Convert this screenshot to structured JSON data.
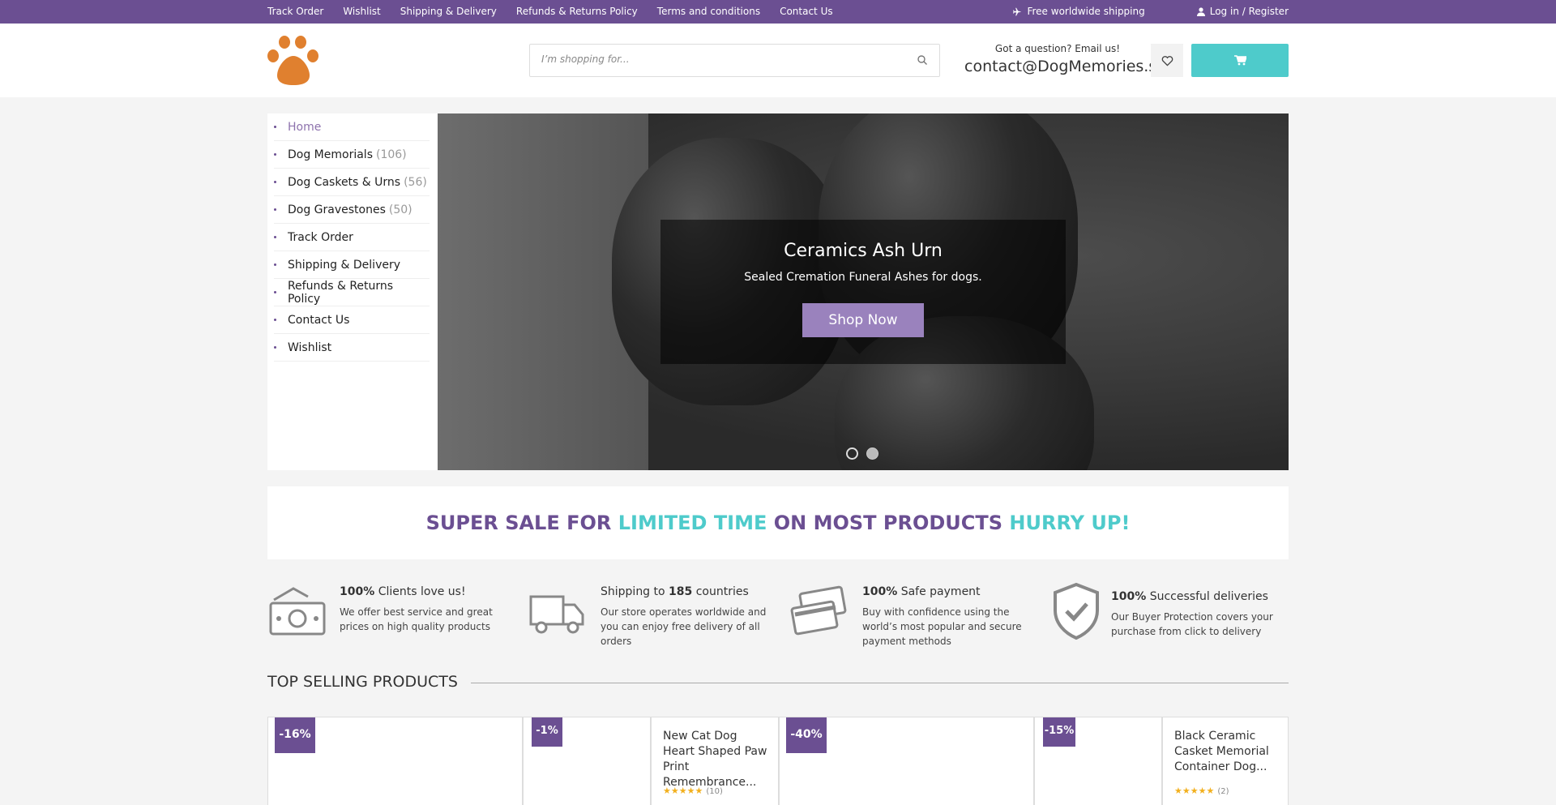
{
  "topbar": {
    "links": [
      "Track Order",
      "Wishlist",
      "Shipping & Delivery",
      "Refunds & Returns Policy",
      "Terms and conditions",
      "Contact Us"
    ],
    "shipping": "Free worldwide shipping",
    "login": "Log in / Register"
  },
  "header": {
    "search_placeholder": "I’m shopping for...",
    "question": "Got a question? Email us!",
    "email": "contact@DogMemories.shop"
  },
  "sidebar": {
    "items": [
      {
        "label": "Home",
        "count": ""
      },
      {
        "label": "Dog Memorials",
        "count": "(106)"
      },
      {
        "label": "Dog Caskets & Urns",
        "count": "(56)"
      },
      {
        "label": "Dog Gravestones",
        "count": "(50)"
      },
      {
        "label": "Track Order",
        "count": ""
      },
      {
        "label": "Shipping & Delivery",
        "count": ""
      },
      {
        "label": "Refunds & Returns Policy",
        "count": ""
      },
      {
        "label": "Contact Us",
        "count": ""
      },
      {
        "label": "Wishlist",
        "count": ""
      }
    ]
  },
  "slider": {
    "title": "Ceramics Ash Urn",
    "subtitle": "Sealed Cremation Funeral Ashes for dogs.",
    "button": "Shop Now"
  },
  "sale": {
    "part1": "SUPER SALE FOR ",
    "part2": "LIMITED TIME",
    "part3": " ON MOST PRODUCTS ",
    "part4": "HURRY UP!"
  },
  "features": [
    {
      "bold": "100%",
      "title": " Clients love us!",
      "desc": "We offer best service and great prices on high quality products",
      "icon": "money-icon"
    },
    {
      "pre": "Shipping to ",
      "bold": "185",
      "title": " countries",
      "desc": "Our store operates worldwide and you can enjoy free delivery of all orders",
      "icon": "truck-icon"
    },
    {
      "bold": "100%",
      "title": " Safe payment",
      "desc": "Buy with confidence using the world’s most popular and secure payment methods",
      "icon": "credit-card-icon"
    },
    {
      "bold": "100%",
      "title": " Successful deliveries",
      "desc": "Our Buyer Protection covers your purchase from click to delivery",
      "icon": "shield-check-icon"
    }
  ],
  "top_selling": {
    "heading": "TOP SELLING PRODUCTS",
    "products": [
      {
        "discount": "-16%",
        "name": "",
        "reviews": ""
      },
      {
        "discount": "-1%",
        "name": "New Cat Dog Heart Shaped Paw Print Remembrance...",
        "reviews": "(10)"
      },
      {
        "discount": "-40%",
        "name": "",
        "reviews": ""
      },
      {
        "discount": "-15%",
        "name": "Black Ceramic Casket Memorial Container Dog...",
        "reviews": "(2)"
      }
    ],
    "stars": "★★★★★"
  },
  "colors": {
    "brand_purple": "#6b4f92",
    "accent_teal": "#4ecbcb",
    "button_lavender": "#9a82bd"
  }
}
